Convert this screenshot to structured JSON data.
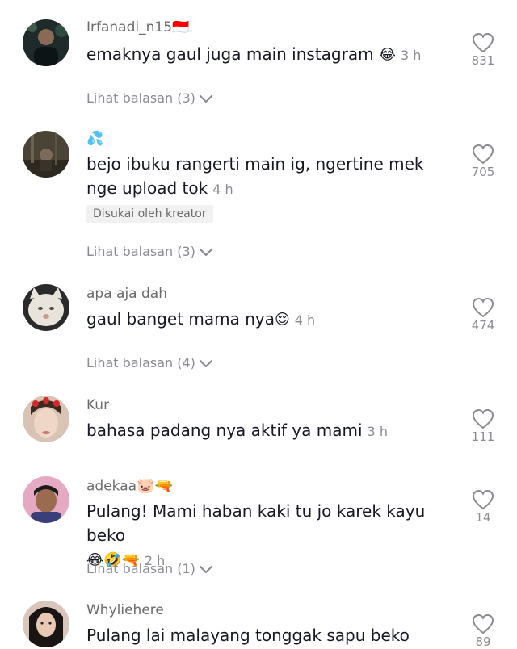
{
  "comments": [
    {
      "username": "Irfanadi_n15",
      "username_suffix": "🇮🇩",
      "text": "emaknya gaul juga main instagram",
      "text_emoji": "😂",
      "time": "3 h",
      "likes": "831",
      "replies_label": "Lihat balasan (3)"
    },
    {
      "username": "💦",
      "text": "bejo ibuku rangerti main ig, ngertine mek nge upload tok",
      "time": "4 h",
      "badge": "Disukai oleh kreator",
      "likes": "705",
      "replies_label": "Lihat balasan (3)"
    },
    {
      "username": "apa aja dah",
      "text": "gaul banget mama nya",
      "text_emoji": "😌",
      "time": "4 h",
      "likes": "474",
      "replies_label": "Lihat balasan (4)"
    },
    {
      "username": "Kur",
      "text": "bahasa padang nya aktif ya mami",
      "time": "3 h",
      "likes": "111"
    },
    {
      "username": "adekaa",
      "username_suffix": "🐷🔫",
      "text": "Pulang! Mami haban kaki tu jo karek kayu beko",
      "text_emoji": "😂🤣🔫",
      "time": "2 h",
      "likes": "14",
      "replies_label": "Lihat balasan (1)"
    },
    {
      "username": "Whyliehere",
      "text": "Pulang lai malayang tonggak sapu beko",
      "likes": "89"
    }
  ],
  "colors": {
    "text": "#161823",
    "secondary": "#8a8b91",
    "badge_bg": "#f1f1f2"
  },
  "icons": [
    "heart-icon",
    "chevron-down-icon",
    "avatar"
  ]
}
